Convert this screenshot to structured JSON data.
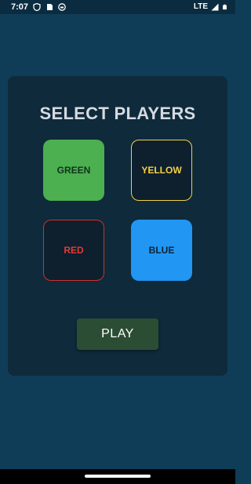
{
  "status_bar": {
    "time": "7:07",
    "network": "LTE",
    "left_icons": [
      "privacy-icon",
      "sim-icon",
      "app-notification-icon"
    ],
    "right_icons": [
      "signal-icon",
      "battery-icon"
    ]
  },
  "screen": {
    "title": "SELECT PLAYERS",
    "players": [
      {
        "label": "GREEN",
        "selected": true,
        "color": "#4caf50"
      },
      {
        "label": "YELLOW",
        "selected": false,
        "color": "#f5d142"
      },
      {
        "label": "RED",
        "selected": false,
        "color": "#d32f2f"
      },
      {
        "label": "BLUE",
        "selected": true,
        "color": "#2196f3"
      }
    ],
    "play_label": "PLAY"
  },
  "theme": {
    "background": "#0f3d57",
    "panel": "#0e2a3b",
    "play_button": "#2b4d34"
  }
}
